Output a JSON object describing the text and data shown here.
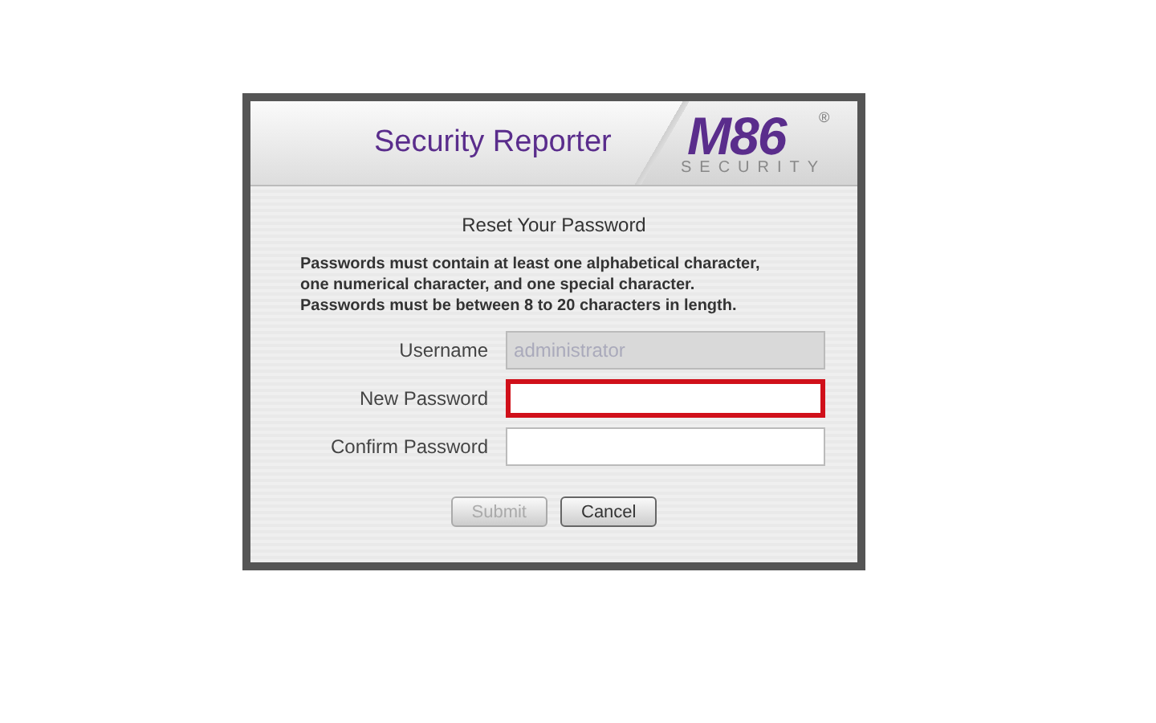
{
  "header": {
    "title": "Security Reporter",
    "logo": {
      "mark": "M86",
      "registered": "®",
      "tagline": "SECURITY"
    }
  },
  "form": {
    "heading": "Reset Your Password",
    "instructions": [
      "Passwords must contain at least one alphabetical character,",
      "one numerical character, and one special character.",
      "Passwords must be between 8 to 20 characters in length."
    ],
    "fields": [
      {
        "label": "Username",
        "value": "administrator",
        "disabled": true,
        "focused": false
      },
      {
        "label": "New Password",
        "disabled": false,
        "focused": true
      },
      {
        "label": "Confirm Password",
        "disabled": false,
        "focused": false
      }
    ],
    "buttons": [
      {
        "label": "Submit",
        "disabled": true
      },
      {
        "label": "Cancel",
        "disabled": false
      }
    ]
  }
}
